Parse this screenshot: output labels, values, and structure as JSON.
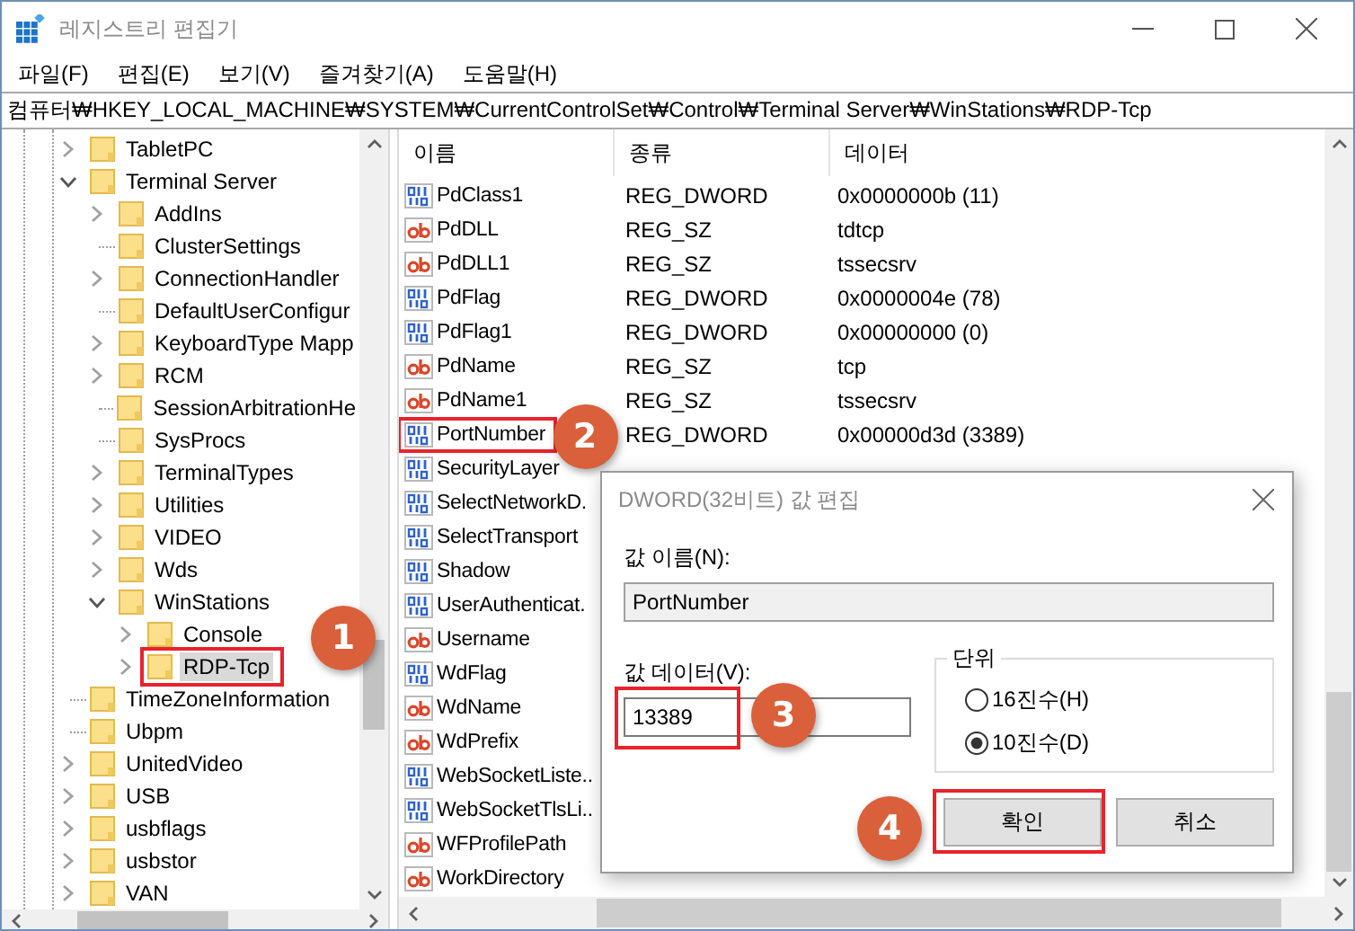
{
  "window": {
    "title": "레지스트리 편집기"
  },
  "menu": [
    "파일(F)",
    "편집(E)",
    "보기(V)",
    "즐겨찾기(A)",
    "도움말(H)"
  ],
  "address": "컴퓨터₩HKEY_LOCAL_MACHINE₩SYSTEM₩CurrentControlSet₩Control₩Terminal Server₩WinStations₩RDP-Tcp",
  "tree": [
    {
      "label": "TabletPC",
      "kind": "branch",
      "expanded": false,
      "selected": false
    },
    {
      "label": "Terminal Server",
      "kind": "branch",
      "expanded": true,
      "selected": false,
      "children": [
        {
          "label": "AddIns",
          "kind": "branch",
          "expanded": false,
          "selected": false
        },
        {
          "label": "ClusterSettings",
          "kind": "leaf",
          "selected": false
        },
        {
          "label": "ConnectionHandler",
          "kind": "branch",
          "expanded": false,
          "selected": false
        },
        {
          "label": "DefaultUserConfigur",
          "kind": "leaf",
          "selected": false
        },
        {
          "label": "KeyboardType Mapp",
          "kind": "branch",
          "expanded": false,
          "selected": false
        },
        {
          "label": "RCM",
          "kind": "branch",
          "expanded": false,
          "selected": false
        },
        {
          "label": "SessionArbitrationHe",
          "kind": "leaf",
          "selected": false
        },
        {
          "label": "SysProcs",
          "kind": "leaf",
          "selected": false
        },
        {
          "label": "TerminalTypes",
          "kind": "branch",
          "expanded": false,
          "selected": false
        },
        {
          "label": "Utilities",
          "kind": "branch",
          "expanded": false,
          "selected": false
        },
        {
          "label": "VIDEO",
          "kind": "branch",
          "expanded": false,
          "selected": false
        },
        {
          "label": "Wds",
          "kind": "branch",
          "expanded": false,
          "selected": false
        },
        {
          "label": "WinStations",
          "kind": "branch",
          "expanded": true,
          "selected": false,
          "children": [
            {
              "label": "Console",
              "kind": "branch",
              "expanded": false,
              "selected": false
            },
            {
              "label": "RDP-Tcp",
              "kind": "branch",
              "expanded": false,
              "selected": true,
              "step": "1"
            }
          ]
        }
      ]
    },
    {
      "label": "TimeZoneInformation",
      "kind": "leaf",
      "selected": false
    },
    {
      "label": "Ubpm",
      "kind": "leaf",
      "selected": false
    },
    {
      "label": "UnitedVideo",
      "kind": "branch",
      "expanded": false,
      "selected": false
    },
    {
      "label": "USB",
      "kind": "branch",
      "expanded": false,
      "selected": false
    },
    {
      "label": "usbflags",
      "kind": "branch",
      "expanded": false,
      "selected": false
    },
    {
      "label": "usbstor",
      "kind": "branch",
      "expanded": false,
      "selected": false
    },
    {
      "label": "VAN",
      "kind": "branch",
      "expanded": false,
      "selected": false
    }
  ],
  "list": {
    "columns": [
      "이름",
      "종류",
      "데이터"
    ],
    "rows": [
      {
        "name": "PdClass1",
        "kind": "dword",
        "type": "REG_DWORD",
        "data": "0x0000000b (11)"
      },
      {
        "name": "PdDLL",
        "kind": "string",
        "type": "REG_SZ",
        "data": "tdtcp"
      },
      {
        "name": "PdDLL1",
        "kind": "string",
        "type": "REG_SZ",
        "data": "tssecsrv"
      },
      {
        "name": "PdFlag",
        "kind": "dword",
        "type": "REG_DWORD",
        "data": "0x0000004e (78)"
      },
      {
        "name": "PdFlag1",
        "kind": "dword",
        "type": "REG_DWORD",
        "data": "0x00000000 (0)"
      },
      {
        "name": "PdName",
        "kind": "string",
        "type": "REG_SZ",
        "data": "tcp"
      },
      {
        "name": "PdName1",
        "kind": "string",
        "type": "REG_SZ",
        "data": "tssecsrv"
      },
      {
        "name": "PortNumber",
        "kind": "dword",
        "type": "REG_DWORD",
        "data": "0x00000d3d (3389)",
        "step": "2"
      },
      {
        "name": "SecurityLayer",
        "kind": "dword"
      },
      {
        "name": "SelectNetworkD.",
        "kind": "dword"
      },
      {
        "name": "SelectTransport",
        "kind": "dword"
      },
      {
        "name": "Shadow",
        "kind": "dword"
      },
      {
        "name": "UserAuthenticat.",
        "kind": "dword"
      },
      {
        "name": "Username",
        "kind": "string"
      },
      {
        "name": "WdFlag",
        "kind": "dword"
      },
      {
        "name": "WdName",
        "kind": "string"
      },
      {
        "name": "WdPrefix",
        "kind": "string"
      },
      {
        "name": "WebSocketListe..",
        "kind": "dword"
      },
      {
        "name": "WebSocketTlsLi..",
        "kind": "dword"
      },
      {
        "name": "WFProfilePath",
        "kind": "string"
      },
      {
        "name": "WorkDirectory",
        "kind": "string"
      }
    ]
  },
  "dialog": {
    "title": "DWORD(32비트) 값 편집",
    "name_label": "값 이름(N):",
    "name_value": "PortNumber",
    "data_label": "값 데이터(V):",
    "data_value": "13389",
    "data_step": "3",
    "base_label": "단위",
    "bases": [
      {
        "label": "16진수(H)",
        "selected": false
      },
      {
        "label": "10진수(D)",
        "selected": true
      }
    ],
    "buttons": [
      {
        "label": "확인",
        "step": "4"
      },
      {
        "label": "취소"
      }
    ]
  }
}
